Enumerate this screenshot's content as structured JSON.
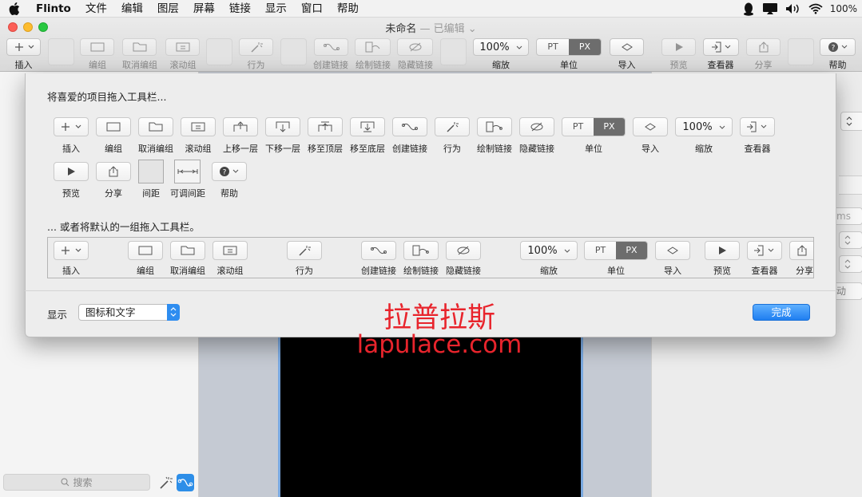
{
  "menubar": {
    "app": "Flinto",
    "items": [
      "文件",
      "编辑",
      "图层",
      "屏幕",
      "链接",
      "显示",
      "窗口",
      "帮助"
    ],
    "battery": "100%"
  },
  "window": {
    "title": "未命名",
    "edited": "— 已编辑 ⌄"
  },
  "toolbar": {
    "insert": "插入",
    "group": "编组",
    "ungroup": "取消编组",
    "scroll_group": "滚动组",
    "behavior": "行为",
    "create_link": "创建链接",
    "draw_link": "绘制链接",
    "hide_link": "隐藏链接",
    "zoom": "缩放",
    "zoom_value": "100%",
    "unit": "单位",
    "unit_pt": "PT",
    "unit_px": "PX",
    "import": "导入",
    "preview": "预览",
    "viewer": "查看器",
    "share": "分享",
    "help": "帮助"
  },
  "sheet": {
    "title_favorites": "将喜爱的项目拖入工具栏...",
    "title_default": "... 或者将默认的一组拖入工具栏。",
    "favorites": {
      "insert": "插入",
      "group": "编组",
      "ungroup": "取消编组",
      "scroll_group": "滚动组",
      "bring_forward": "上移一层",
      "send_backward": "下移一层",
      "bring_front": "移至顶层",
      "send_back": "移至底层",
      "create_link": "创建链接",
      "behavior": "行为",
      "draw_link": "绘制链接",
      "hide_link": "隐藏链接",
      "unit": "单位",
      "import": "导入",
      "zoom": "缩放",
      "viewer": "查看器",
      "preview": "预览",
      "share": "分享",
      "space": "间距",
      "flex_space": "可调间距",
      "help": "帮助"
    },
    "default_set": {
      "insert": "插入",
      "group": "编组",
      "ungroup": "取消编组",
      "scroll_group": "滚动组",
      "behavior": "行为",
      "create_link": "创建链接",
      "draw_link": "绘制链接",
      "hide_link": "隐藏链接",
      "zoom": "缩放",
      "unit": "单位",
      "import": "导入",
      "preview": "预览",
      "viewer": "查看器",
      "share": "分享"
    },
    "show_label": "显示",
    "show_value": "图标和文字",
    "done": "完成"
  },
  "sidebar": {
    "search_placeholder": "搜索"
  },
  "inspector": {
    "partial_ms": "ms",
    "partial_dong": "动"
  },
  "watermark": {
    "line1": "拉普拉斯",
    "line2": "lapulace.com"
  },
  "colors": {
    "accent": "#2e8df0",
    "watermark": "#e8242c"
  }
}
